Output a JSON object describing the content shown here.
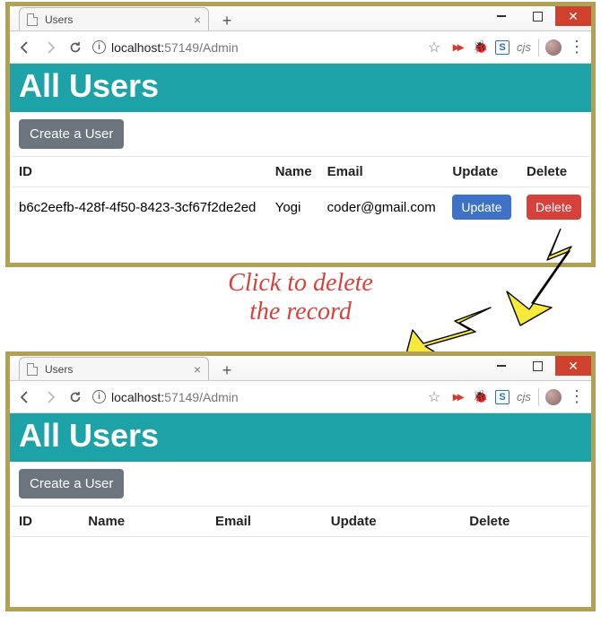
{
  "browser": {
    "tab_title": "Users",
    "new_tab_label": "+",
    "close_label": "✕",
    "url_host": "localhost:",
    "url_port_path": "57149/Admin",
    "cjs_label": "cjs"
  },
  "page": {
    "heading": "All Users",
    "create_button": "Create a User",
    "columns": {
      "id": "ID",
      "name": "Name",
      "email": "Email",
      "update": "Update",
      "delete": "Delete"
    }
  },
  "rows_before": [
    {
      "id": "b6c2eefb-428f-4f50-8423-3cf67f2de2ed",
      "name": "Yogi",
      "email": "coder@gmail.com",
      "update_label": "Update",
      "delete_label": "Delete"
    }
  ],
  "annotation": {
    "line1": "Click to delete",
    "line2": "the record"
  }
}
